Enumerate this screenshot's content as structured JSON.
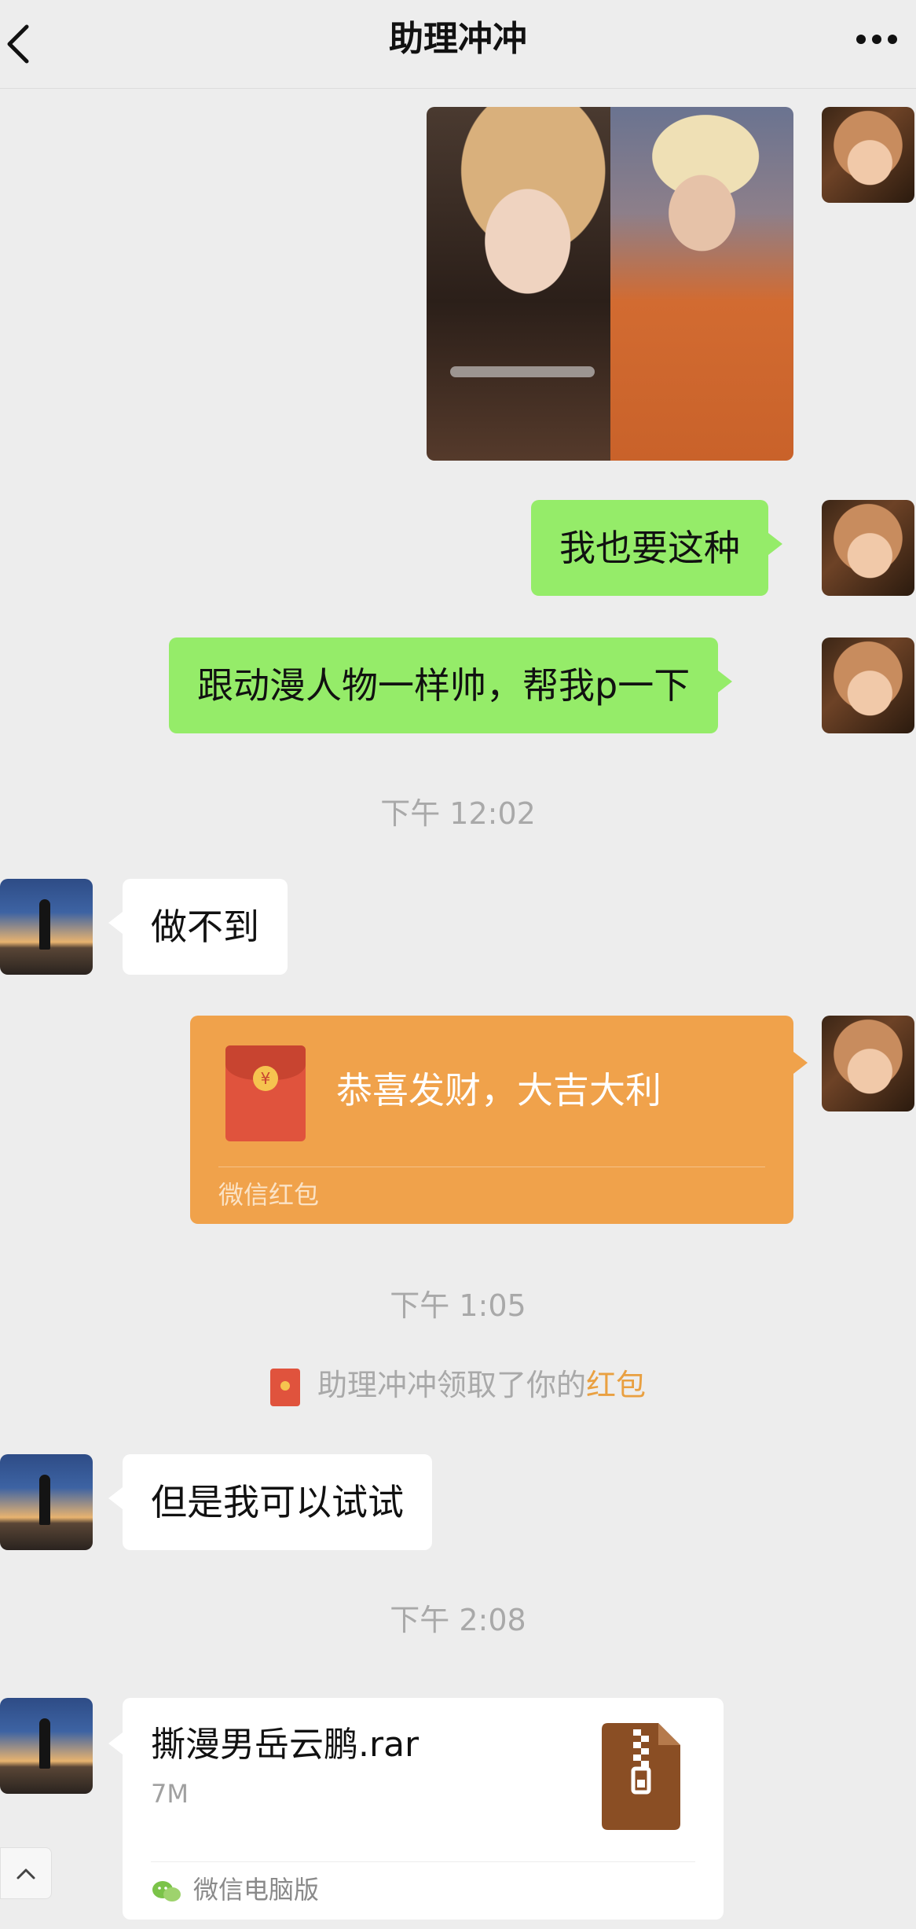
{
  "header": {
    "title": "助理冲冲",
    "back_icon": "chevron-left-icon",
    "more_icon": "ellipsis-icon"
  },
  "messages": [
    {
      "id": "m1",
      "from": "me",
      "type": "image"
    },
    {
      "id": "m2",
      "from": "me",
      "type": "text",
      "text": "我也要这种"
    },
    {
      "id": "m3",
      "from": "me",
      "type": "text",
      "text": "跟动漫人物一样帅，帮我p一下"
    },
    {
      "id": "t1",
      "type": "time",
      "text": "下午 12:02"
    },
    {
      "id": "m4",
      "from": "other",
      "type": "text",
      "text": "做不到"
    },
    {
      "id": "m5",
      "from": "me",
      "type": "red_packet",
      "text": "恭喜发财，大吉大利",
      "footer": "微信红包"
    },
    {
      "id": "t2",
      "type": "time",
      "text": "下午 1:05"
    },
    {
      "id": "s1",
      "type": "system",
      "text": "助理冲冲领取了你的",
      "link": "红包"
    },
    {
      "id": "m6",
      "from": "other",
      "type": "text",
      "text": "但是我可以试试"
    },
    {
      "id": "t3",
      "type": "time",
      "text": "下午 2:08"
    },
    {
      "id": "m7",
      "from": "other",
      "type": "file",
      "name": "撕漫男岳云鹏.rar",
      "size": "7M",
      "source": "微信电脑版"
    }
  ],
  "colors": {
    "background": "#ededed",
    "my_bubble": "#95ec69",
    "other_bubble": "#ffffff",
    "red_packet": "#f0a24b",
    "timestamp": "#a9a9a9",
    "link": "#e9a041",
    "rar_icon": "#8a4e24"
  }
}
